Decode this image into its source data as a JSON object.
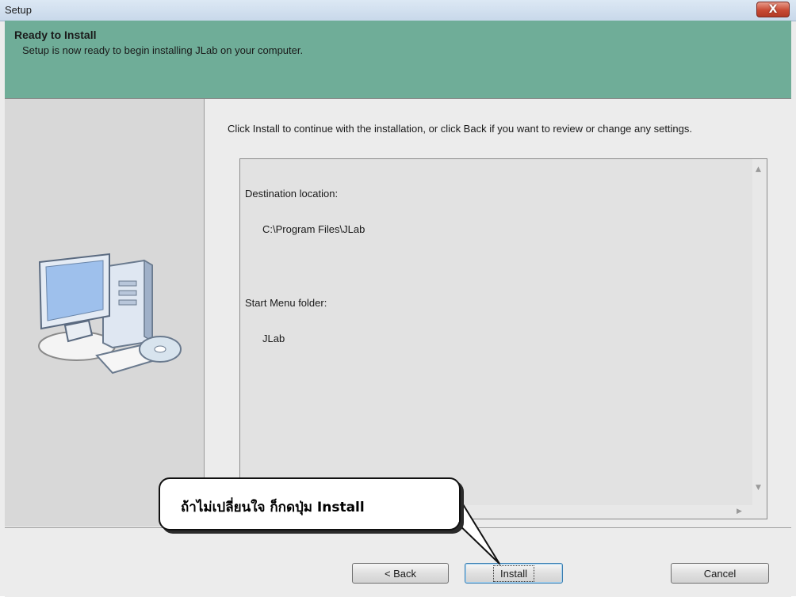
{
  "window": {
    "title": "Setup",
    "close_label": "X"
  },
  "header": {
    "title": "Ready to Install",
    "subtitle": "Setup is now ready to begin installing JLab on your computer."
  },
  "body": {
    "instruction": "Click Install to continue with the installation, or click Back if you want to review or change any settings.",
    "summary": {
      "destination_label": "Destination location:",
      "destination_value": "C:\\Program Files\\JLab",
      "start_menu_label": "Start Menu folder:",
      "start_menu_value": "JLab"
    }
  },
  "buttons": {
    "back_label": "< Back",
    "install_label": "Install",
    "cancel_label": "Cancel"
  },
  "callout": {
    "text": "ถ้าไม่เปลี่ยนใจ ก็กดปุ่ม Install"
  },
  "icons": {
    "computer": "computer-setup-icon",
    "close": "close-icon",
    "scroll_up": "scroll-up-arrow-icon",
    "scroll_down": "scroll-down-arrow-icon",
    "scroll_right": "scroll-right-arrow-icon"
  },
  "colors": {
    "header_bg": "#6fad98",
    "close_btn": "#c84a34",
    "default_button_border": "#3c7fb1"
  }
}
